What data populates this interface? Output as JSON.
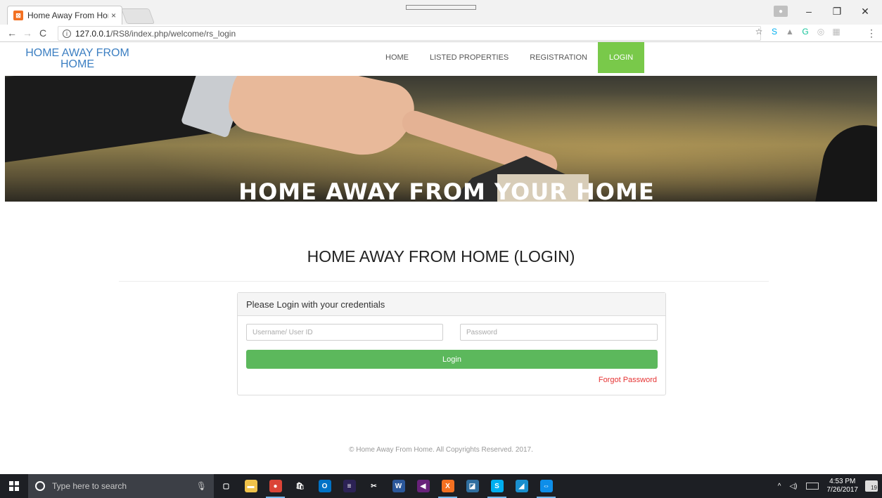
{
  "browser": {
    "tab_title": "Home Away From Home",
    "tab_close": "×",
    "url_host": "127.0.0.1",
    "url_path": "/RS8/index.php/welcome/rs_login",
    "back": "←",
    "forward": "→",
    "reload": "C",
    "info": "i",
    "bookmark_star": "☆",
    "minimize": "–",
    "restore": "❐",
    "close": "✕",
    "menu": "⋮",
    "extensions": [
      {
        "name": "skype-icon",
        "glyph": "S",
        "color": "#00aff0"
      },
      {
        "name": "drive-icon",
        "glyph": "▲",
        "color": "#999999"
      },
      {
        "name": "grammarly-icon",
        "glyph": "G",
        "color": "#15c39a"
      },
      {
        "name": "extension-icon",
        "glyph": "◎",
        "color": "#bbbbbb"
      },
      {
        "name": "extension2-icon",
        "glyph": "▦",
        "color": "#bbbbbb"
      }
    ]
  },
  "nav": {
    "brand": "HOME AWAY FROM HOME",
    "links": [
      "HOME",
      "LISTED PROPERTIES",
      "REGISTRATION",
      "LOGIN"
    ],
    "active_color": "#79c94a"
  },
  "hero": {
    "text": "HOME AWAY FROM YOUR HOME"
  },
  "main": {
    "title": "HOME AWAY FROM HOME (LOGIN)",
    "panel_heading": "Please Login with your credentials",
    "username_placeholder": "Username/ User ID",
    "password_placeholder": "Password",
    "login_label": "Login",
    "forgot_label": "Forgot Password",
    "login_color": "#5cb85c",
    "forgot_color": "#e53333"
  },
  "footer": {
    "text": "© Home Away From Home. All Copyrights Reserved. 2017."
  },
  "taskbar": {
    "search_placeholder": "Type here to search",
    "apps": [
      {
        "name": "task-view-icon",
        "glyph": "▢",
        "color": "transparent",
        "running": false
      },
      {
        "name": "file-explorer-icon",
        "glyph": "▬",
        "color": "#f0c24a",
        "running": false
      },
      {
        "name": "chrome-icon",
        "glyph": "●",
        "color": "#db4437",
        "running": true
      },
      {
        "name": "store-icon",
        "glyph": "🛍",
        "color": "transparent",
        "running": false
      },
      {
        "name": "outlook-icon",
        "glyph": "O",
        "color": "#0072c6",
        "running": false
      },
      {
        "name": "eclipse-icon",
        "glyph": "≡",
        "color": "#2c2255",
        "running": false
      },
      {
        "name": "tools-icon",
        "glyph": "✂",
        "color": "transparent",
        "running": false
      },
      {
        "name": "word-icon",
        "glyph": "W",
        "color": "#2b579a",
        "running": false
      },
      {
        "name": "visual-studio-icon",
        "glyph": "◀",
        "color": "#68217a",
        "running": false
      },
      {
        "name": "xampp-icon",
        "glyph": "X",
        "color": "#f37021",
        "running": true
      },
      {
        "name": "database-icon",
        "glyph": "◪",
        "color": "#2f6e9f",
        "running": false
      },
      {
        "name": "skype-business-icon",
        "glyph": "S",
        "color": "#00aff0",
        "running": true
      },
      {
        "name": "photos-icon",
        "glyph": "◢",
        "color": "#1a8fce",
        "running": false
      },
      {
        "name": "teamviewer-icon",
        "glyph": "⇔",
        "color": "#0e8ee9",
        "running": true
      }
    ],
    "time": "4:53 PM",
    "date": "7/26/2017",
    "notif_count": "19"
  }
}
